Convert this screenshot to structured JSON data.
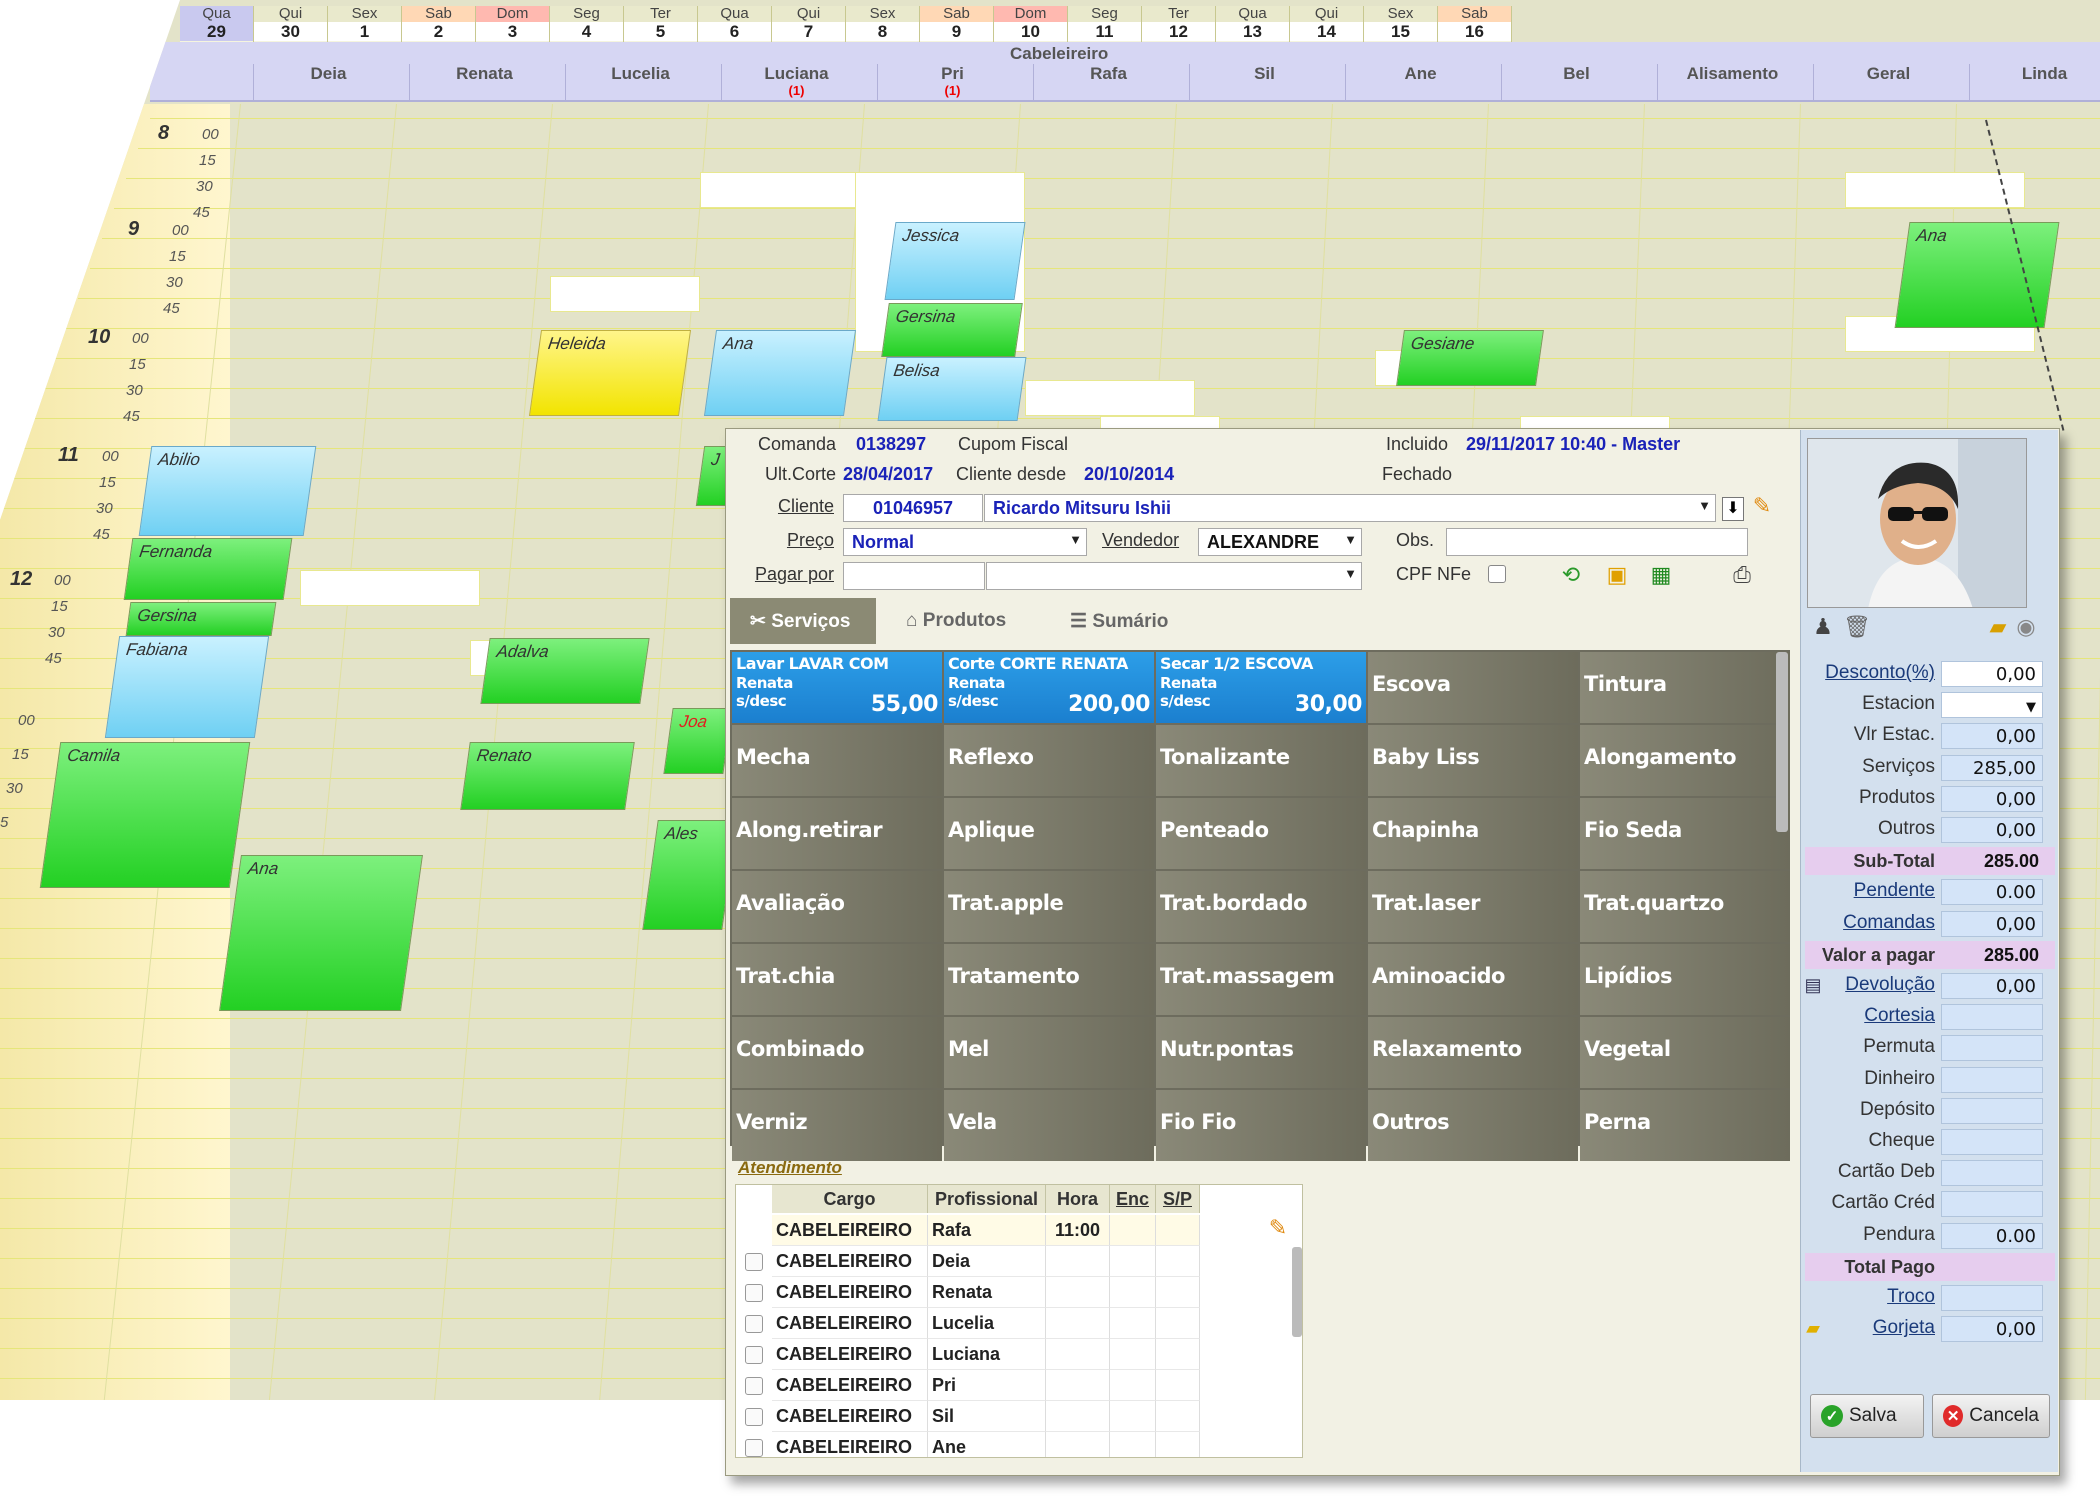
{
  "calendar": {
    "days": [
      {
        "name": "Qua",
        "num": "29",
        "kind": "today"
      },
      {
        "name": "Qui",
        "num": "30",
        "kind": ""
      },
      {
        "name": "Sex",
        "num": "1",
        "kind": ""
      },
      {
        "name": "Sab",
        "num": "2",
        "kind": "sat"
      },
      {
        "name": "Dom",
        "num": "3",
        "kind": "sun"
      },
      {
        "name": "Seg",
        "num": "4",
        "kind": ""
      },
      {
        "name": "Ter",
        "num": "5",
        "kind": ""
      },
      {
        "name": "Qua",
        "num": "6",
        "kind": ""
      },
      {
        "name": "Qui",
        "num": "7",
        "kind": ""
      },
      {
        "name": "Sex",
        "num": "8",
        "kind": ""
      },
      {
        "name": "Sab",
        "num": "9",
        "kind": "sat"
      },
      {
        "name": "Dom",
        "num": "10",
        "kind": "sun"
      },
      {
        "name": "Seg",
        "num": "11",
        "kind": ""
      },
      {
        "name": "Ter",
        "num": "12",
        "kind": ""
      },
      {
        "name": "Qua",
        "num": "13",
        "kind": ""
      },
      {
        "name": "Qui",
        "num": "14",
        "kind": ""
      },
      {
        "name": "Sex",
        "num": "15",
        "kind": ""
      },
      {
        "name": "Sab",
        "num": "16",
        "kind": "sat"
      }
    ],
    "department": "Cabeleireiro",
    "professionals": [
      {
        "name": "Deia",
        "count": ""
      },
      {
        "name": "Renata",
        "count": ""
      },
      {
        "name": "Lucelia",
        "count": ""
      },
      {
        "name": "Luciana",
        "count": "(1)"
      },
      {
        "name": "Pri",
        "count": "(1)"
      },
      {
        "name": "Rafa",
        "count": ""
      },
      {
        "name": "Sil",
        "count": ""
      },
      {
        "name": "Ane",
        "count": ""
      },
      {
        "name": "Bel",
        "count": ""
      },
      {
        "name": "Alisamento",
        "count": ""
      },
      {
        "name": "Geral",
        "count": ""
      },
      {
        "name": "Linda",
        "count": ""
      }
    ],
    "hours": [
      "8",
      "9",
      "10",
      "11",
      "12"
    ],
    "minutes": [
      "00",
      "15",
      "30",
      "45"
    ],
    "trailing_minutes": [
      "00",
      "15",
      "30",
      "5"
    ],
    "appointments": [
      {
        "name": "Jessica",
        "color": "blue"
      },
      {
        "name": "Gersina",
        "color": "green"
      },
      {
        "name": "Belisa",
        "color": "blue"
      },
      {
        "name": "Ana",
        "color": "green"
      },
      {
        "name": "Heleida",
        "color": "yellow"
      },
      {
        "name": "Ana",
        "color": "blue"
      },
      {
        "name": "Gesiane",
        "color": "green"
      },
      {
        "name": "Abilio",
        "color": "blue"
      },
      {
        "name": "Fernanda",
        "color": "green"
      },
      {
        "name": "Gersina",
        "color": "green"
      },
      {
        "name": "Fabiana",
        "color": "blue"
      },
      {
        "name": "Adalva",
        "color": "green"
      },
      {
        "name": "Camila",
        "color": "green"
      },
      {
        "name": "Renato",
        "color": "green"
      },
      {
        "name": "Ana",
        "color": "green"
      },
      {
        "name": "Joa",
        "color": "green"
      },
      {
        "name": "Ales",
        "color": "green"
      },
      {
        "name": "J",
        "color": "green"
      }
    ]
  },
  "comanda": {
    "comanda_label": "Comanda",
    "comanda_value": "0138297",
    "cupom_label": "Cupom Fiscal",
    "incluido_label": "Incluido",
    "incluido_value": "29/11/2017 10:40 - Master",
    "ult_corte_label": "Ult.Corte",
    "ult_corte_value": "28/04/2017",
    "cliente_desde_label": "Cliente desde",
    "cliente_desde_value": "20/10/2014",
    "fechado_label": "Fechado",
    "cliente_label": "Cliente",
    "cliente_code": "01046957",
    "cliente_name": "Ricardo Mitsuru Ishii",
    "preco_label": "Preço",
    "preco_value": "Normal",
    "vendedor_label": "Vendedor",
    "vendedor_value": "ALEXANDRE",
    "obs_label": "Obs.",
    "pagar_por_label": "Pagar por",
    "cpf_label": "CPF NFe"
  },
  "tabs": [
    {
      "label": "Serviços",
      "icon": "scissors-icon"
    },
    {
      "label": "Produtos",
      "icon": "basket-icon"
    },
    {
      "label": "Sumário",
      "icon": "list-icon"
    }
  ],
  "selected_services": [
    {
      "title": "Lavar LAVAR COM",
      "prof": "Renata",
      "desc": "s/desc",
      "price": "55,00"
    },
    {
      "title": "Corte CORTE RENATA",
      "prof": "Renata",
      "desc": "s/desc",
      "price": "200,00"
    },
    {
      "title": "Secar 1/2 ESCOVA",
      "prof": "Renata",
      "desc": "s/desc",
      "price": "30,00"
    }
  ],
  "services": [
    "Escova",
    "Tintura",
    "Mecha",
    "Reflexo",
    "Tonalizante",
    "Baby Liss",
    "Alongamento",
    "Along.retirar",
    "Aplique",
    "Penteado",
    "Chapinha",
    "Fio Seda",
    "Avaliação",
    "Trat.apple",
    "Trat.bordado",
    "Trat.laser",
    "Trat.quartzo",
    "Trat.chia",
    "Tratamento",
    "Trat.massagem",
    "Aminoacido",
    "Lipídios",
    "Combinado",
    "Mel",
    "Nutr.pontas",
    "Relaxamento",
    "Vegetal",
    "Verniz",
    "Vela",
    "Fio Fio",
    "Outros",
    "Perna"
  ],
  "atendimento": {
    "title": "Atendimento",
    "headers": [
      "Cargo",
      "Profissional",
      "Hora",
      "Enc",
      "S/P"
    ],
    "rows": [
      {
        "cargo": "CABELEIREIRO",
        "prof": "Rafa",
        "hora": "11:00"
      },
      {
        "cargo": "CABELEIREIRO",
        "prof": "Deia",
        "hora": ""
      },
      {
        "cargo": "CABELEIREIRO",
        "prof": "Renata",
        "hora": ""
      },
      {
        "cargo": "CABELEIREIRO",
        "prof": "Lucelia",
        "hora": ""
      },
      {
        "cargo": "CABELEIREIRO",
        "prof": "Luciana",
        "hora": ""
      },
      {
        "cargo": "CABELEIREIRO",
        "prof": "Pri",
        "hora": ""
      },
      {
        "cargo": "CABELEIREIRO",
        "prof": "Sil",
        "hora": ""
      },
      {
        "cargo": "CABELEIREIRO",
        "prof": "Ane",
        "hora": ""
      }
    ]
  },
  "totals": {
    "desconto_label": "Desconto(%)",
    "desconto": "0,00",
    "estacion_label": "Estacion",
    "vlr_estac_label": "Vlr Estac.",
    "vlr_estac": "0,00",
    "servicos_label": "Serviços",
    "servicos": "285,00",
    "produtos_label": "Produtos",
    "produtos": "0,00",
    "outros_label": "Outros",
    "outros": "0,00",
    "subtotal_label": "Sub-Total",
    "subtotal": "285.00",
    "pendente_label": "Pendente",
    "pendente": "0.00",
    "comandas_label": "Comandas",
    "comandas": "0,00",
    "valor_pagar_label": "Valor a pagar",
    "valor_pagar": "285.00",
    "devolucao_label": "Devolução",
    "devolucao": "0,00",
    "cortesia_label": "Cortesia",
    "permuta_label": "Permuta",
    "dinheiro_label": "Dinheiro",
    "deposito_label": "Depósito",
    "cheque_label": "Cheque",
    "cartao_deb_label": "Cartão Deb",
    "cartao_cred_label": "Cartão Créd",
    "pendura_label": "Pendura",
    "pendura": "0.00",
    "total_pago_label": "Total Pago",
    "troco_label": "Troco",
    "gorjeta_label": "Gorjeta",
    "gorjeta": "0,00"
  },
  "buttons": {
    "salva": "Salva",
    "cancela": "Cancela"
  }
}
